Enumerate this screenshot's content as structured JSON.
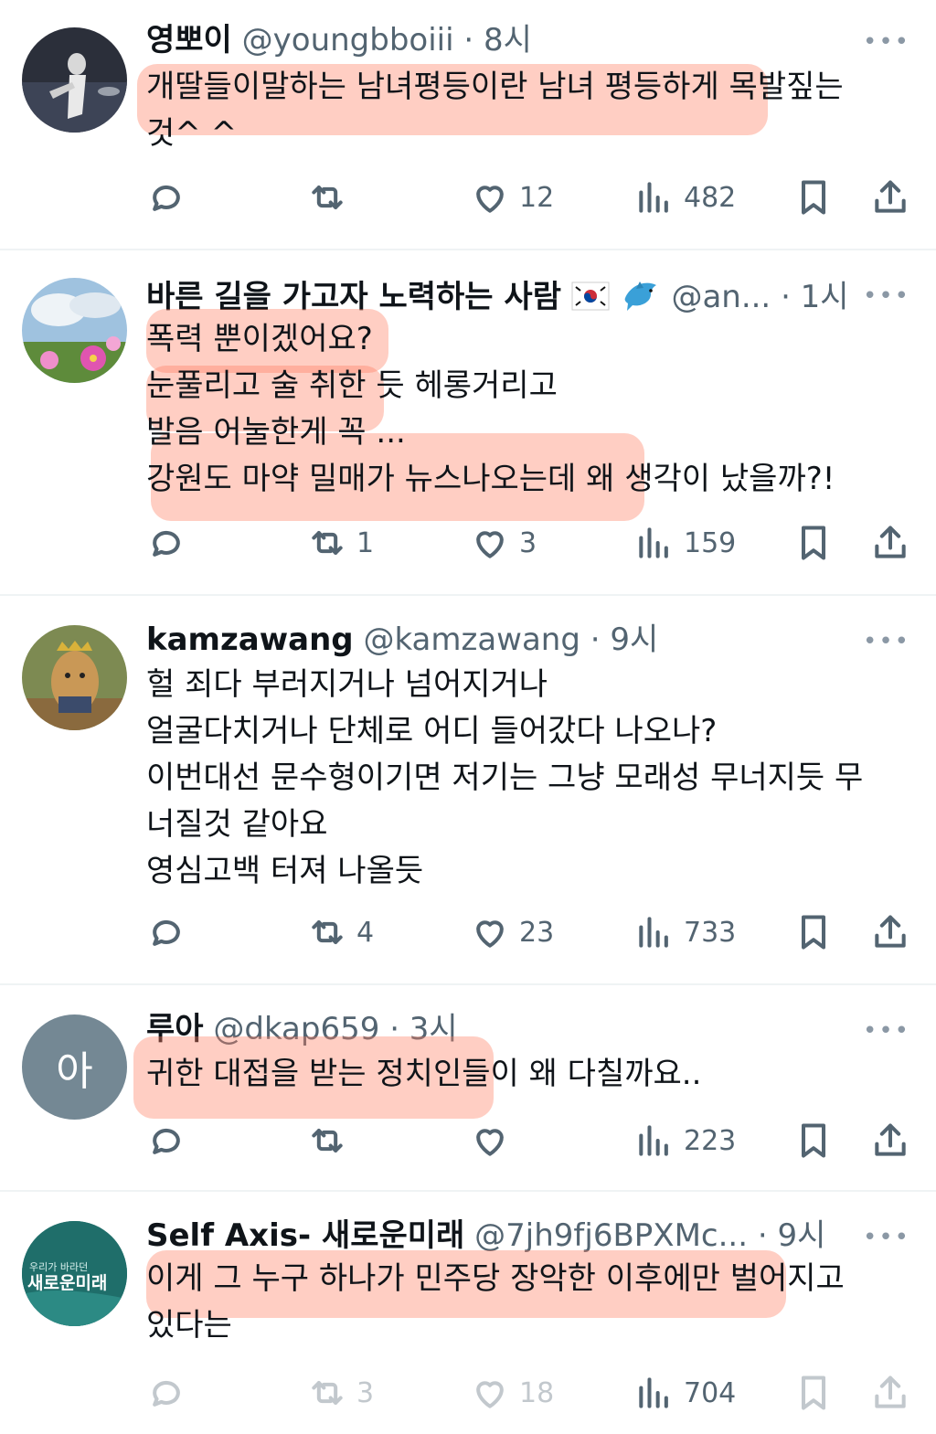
{
  "tweets": [
    {
      "name": "영뽀이",
      "handle": "@youngbboiii",
      "time": "· 8시",
      "lines": [
        "개딸들이말하는 남녀평등이란 남녀 평등하게 목발짚는",
        "것^ ^"
      ],
      "reply": "",
      "retweet": "",
      "like": "12",
      "views": "482"
    },
    {
      "name": "바른 길을 가고자 노력하는 사람",
      "handle": "@an...",
      "time": "· 1시",
      "lines": [
        "폭력 뿐이겠어요?",
        "눈풀리고 술 취한 듯 헤롱거리고",
        "발음 어눌한게 꼭 ...",
        "강원도 마약 밀매가 뉴스나오는데 왜 생각이 났을까?!"
      ],
      "reply": "",
      "retweet": "1",
      "like": "3",
      "views": "159"
    },
    {
      "name": "kamzawang",
      "handle": "@kamzawang",
      "time": "· 9시",
      "lines": [
        "헐 죄다 부러지거나 넘어지거나",
        "얼굴다치거나 단체로 어디 들어갔다 나오나?",
        "이번대선 문수형이기면 저기는 그냥 모래성 무너지듯 무",
        "너질것 같아요",
        "영심고백 터져 나올듯"
      ],
      "reply": "",
      "retweet": "4",
      "like": "23",
      "views": "733"
    },
    {
      "name": "루아",
      "handle": "@dkap659",
      "time": "· 3시",
      "avatar_letter": "아",
      "lines": [
        "귀한 대접을 받는 정치인들이 왜 다칠까요.."
      ],
      "reply": "",
      "retweet": "",
      "like": "",
      "views": "223"
    },
    {
      "name": "Self Axis- 새로운미래",
      "handle": "@7jh9fj6BPXMc...",
      "time": "· 9시",
      "avatar_small": "우리가 바라던",
      "avatar_big": "새로운미래",
      "lines": [
        "이게 그 누구 하나가 민주당 장악한 이후에만 벌어지고",
        "있다는"
      ],
      "reply": "",
      "retweet": "3",
      "like": "18",
      "views": "704"
    }
  ],
  "more_label": "•••",
  "colors": {
    "highlight": "#ff7e60",
    "secondary": "#536471",
    "divider": "#eff3f4"
  },
  "icons": [
    "reply-icon",
    "retweet-icon",
    "like-icon",
    "views-icon",
    "bookmark-icon",
    "share-icon"
  ]
}
